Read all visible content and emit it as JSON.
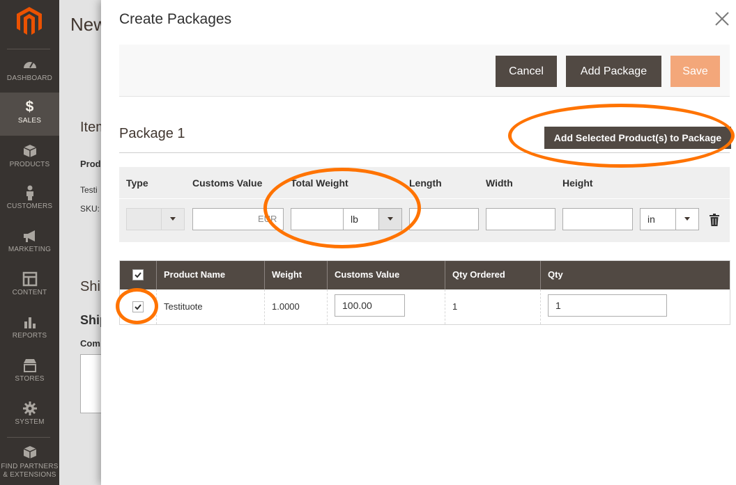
{
  "sidebar": {
    "logo": "magento-logo",
    "items": [
      {
        "label": "DASHBOARD",
        "icon": "dashboard-icon"
      },
      {
        "label": "SALES",
        "icon": "dollar-icon"
      },
      {
        "label": "PRODUCTS",
        "icon": "cube-icon"
      },
      {
        "label": "CUSTOMERS",
        "icon": "person-icon"
      },
      {
        "label": "MARKETING",
        "icon": "megaphone-icon"
      },
      {
        "label": "CONTENT",
        "icon": "layout-icon"
      },
      {
        "label": "REPORTS",
        "icon": "bar-chart-icon"
      },
      {
        "label": "STORES",
        "icon": "store-icon"
      },
      {
        "label": "SYSTEM",
        "icon": "gear-icon"
      }
    ],
    "partners": {
      "line1": "FIND PARTNERS",
      "line2": "& EXTENSIONS",
      "icon": "box-icon"
    }
  },
  "background_page": {
    "title": "New",
    "items_heading": "Item",
    "product_label": "Prod",
    "product_value": "Testi",
    "sku_label": "SKU:",
    "shipping_heading": "Shi",
    "shipping_sub": "Ship",
    "comment_label": "Com"
  },
  "modal": {
    "title": "Create Packages",
    "buttons": {
      "cancel": "Cancel",
      "add_package": "Add Package",
      "save": "Save"
    },
    "package": {
      "title": "Package 1",
      "add_selected": "Add Selected Product(s) to Package",
      "headers": {
        "type": "Type",
        "customs_value": "Customs Value",
        "total_weight": "Total Weight",
        "length": "Length",
        "width": "Width",
        "height": "Height"
      },
      "customs_currency": "EUR",
      "weight_unit": "lb",
      "dimension_unit": "in",
      "values": {
        "customs_value": "",
        "total_weight": "",
        "length": "",
        "width": "",
        "height": ""
      }
    },
    "items_table": {
      "headers": {
        "product_name": "Product Name",
        "weight": "Weight",
        "customs_value": "Customs Value",
        "qty_ordered": "Qty Ordered",
        "qty": "Qty"
      },
      "rows": [
        {
          "checked": true,
          "product_name": "Testituote",
          "weight": "1.0000",
          "customs_value": "100.00",
          "qty_ordered": "1",
          "qty": "1"
        }
      ]
    }
  },
  "colors": {
    "sidebar_bg": "#373330",
    "primary_button": "#514943",
    "save_button": "#f3a77a",
    "annotation": "#ff7300",
    "logo_orange": "#eb5202"
  }
}
